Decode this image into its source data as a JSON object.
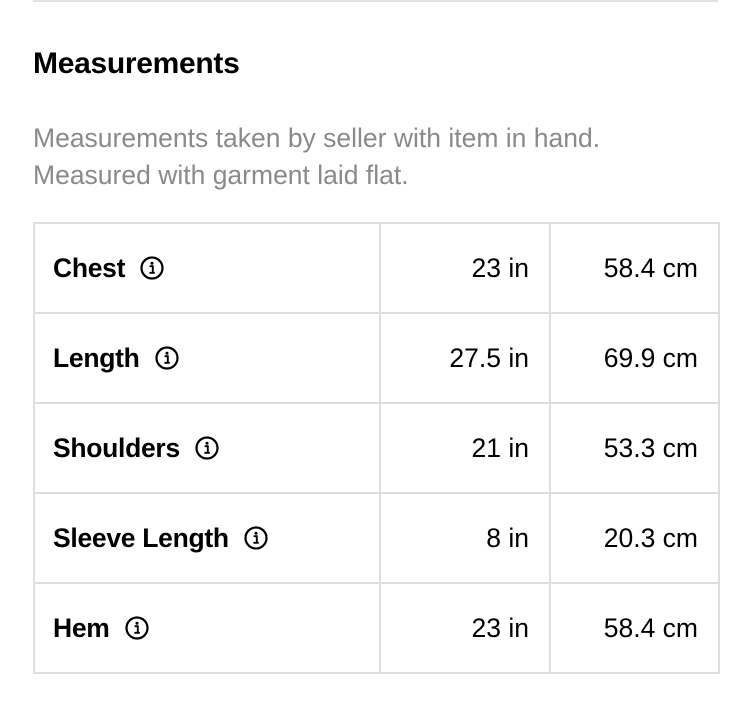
{
  "section": {
    "title": "Measurements",
    "description_line1": "Measurements taken by seller with item in hand.",
    "description_line2": "Measured with garment laid flat."
  },
  "rows": [
    {
      "label": "Chest",
      "inches": "23 in",
      "cm": "58.4 cm",
      "icon": "info-icon"
    },
    {
      "label": "Length",
      "inches": "27.5 in",
      "cm": "69.9 cm",
      "icon": "info-icon"
    },
    {
      "label": "Shoulders",
      "inches": "21 in",
      "cm": "53.3 cm",
      "icon": "info-icon"
    },
    {
      "label": "Sleeve Length",
      "inches": "8 in",
      "cm": "20.3 cm",
      "icon": "info-icon"
    },
    {
      "label": "Hem",
      "inches": "23 in",
      "cm": "58.4 cm",
      "icon": "info-icon"
    }
  ],
  "colors": {
    "text": "#000000",
    "muted_text": "#8a8a8a",
    "border": "#dedede"
  }
}
